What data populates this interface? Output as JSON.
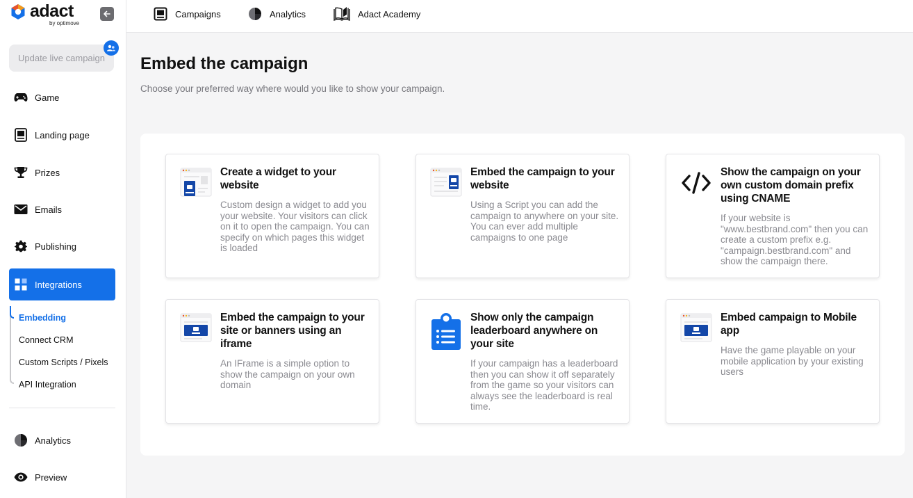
{
  "brand": {
    "name": "adact",
    "sub": "by optimove",
    "accent": "#1470e8"
  },
  "sidebar": {
    "update_label": "Update live campaign",
    "items": [
      {
        "label": "Game",
        "icon": "gamepad-icon"
      },
      {
        "label": "Landing page",
        "icon": "landing-page-icon"
      },
      {
        "label": "Prizes",
        "icon": "trophy-icon"
      },
      {
        "label": "Emails",
        "icon": "envelope-icon"
      },
      {
        "label": "Publishing",
        "icon": "gear-icon"
      },
      {
        "label": "Integrations",
        "icon": "integrations-icon"
      }
    ],
    "subitems": [
      {
        "label": "Embedding"
      },
      {
        "label": "Connect CRM"
      },
      {
        "label": "Custom Scripts / Pixels"
      },
      {
        "label": "API Integration"
      }
    ],
    "bottom": [
      {
        "label": "Analytics",
        "icon": "pie-chart-icon"
      },
      {
        "label": "Preview",
        "icon": "eye-icon"
      }
    ]
  },
  "topbar": {
    "items": [
      {
        "label": "Campaigns",
        "icon": "campaigns-icon"
      },
      {
        "label": "Analytics",
        "icon": "pie-chart-icon"
      },
      {
        "label": "Adact Academy",
        "icon": "book-icon"
      }
    ]
  },
  "main": {
    "title": "Embed the campaign",
    "subtitle": "Choose your preferred way where would you like to show your campaign.",
    "cards": [
      {
        "title": "Create a widget to your website",
        "description": "Custom design a widget to add you your website. Your visitors can click on it to open the campaign. You can specify on which pages this widget is loaded",
        "icon": "widget-icon"
      },
      {
        "title": "Embed the campaign to your website",
        "description": "Using a Script you can add the campaign to anywhere on your site. You can ever add multiple campaigns to one page",
        "icon": "script-embed-icon"
      },
      {
        "title": "Show the campaign on your own custom domain prefix using CNAME",
        "description": "If your website is \"www.bestbrand.com\" then you can create a custom prefix e.g. \"campaign.bestbrand.com\" and show the campaign there.",
        "icon": "code-icon"
      },
      {
        "title": "Embed the campaign to your site or banners using an iframe",
        "description": "An IFrame is a simple option to show the campaign on your own domain",
        "icon": "iframe-icon"
      },
      {
        "title": "Show only the campaign leaderboard anywhere on your site",
        "description": "If your campaign has a leaderboard then you can show it off separately from the game so your visitors can always see the leaderboard is real time.",
        "icon": "leaderboard-icon"
      },
      {
        "title": "Embed campaign to Mobile app",
        "description": "Have the game playable on your mobile application by your existing users",
        "icon": "mobile-app-icon"
      }
    ]
  }
}
